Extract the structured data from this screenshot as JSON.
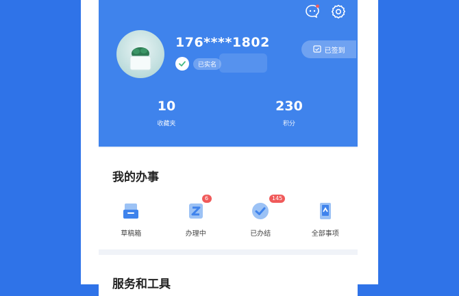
{
  "profile": {
    "phone": "176****1802",
    "verified_label": "已实名",
    "signin_label": "已签到"
  },
  "stats": {
    "favorites": {
      "value": "10",
      "label": "收藏夹"
    },
    "points": {
      "value": "230",
      "label": "积分"
    }
  },
  "my_tasks": {
    "title": "我的办事",
    "items": [
      {
        "label": "草稿箱",
        "icon": "drafts-icon",
        "badge": ""
      },
      {
        "label": "办理中",
        "icon": "in-progress-icon",
        "badge": "6"
      },
      {
        "label": "已办结",
        "icon": "completed-icon",
        "badge": "145"
      },
      {
        "label": "全部事项",
        "icon": "all-items-icon",
        "badge": ""
      }
    ]
  },
  "services": {
    "title": "服务和工具"
  },
  "colors": {
    "header_blue": "#3f83ec",
    "page_background": "#2f73e8",
    "badge_red": "#f05a5a"
  }
}
